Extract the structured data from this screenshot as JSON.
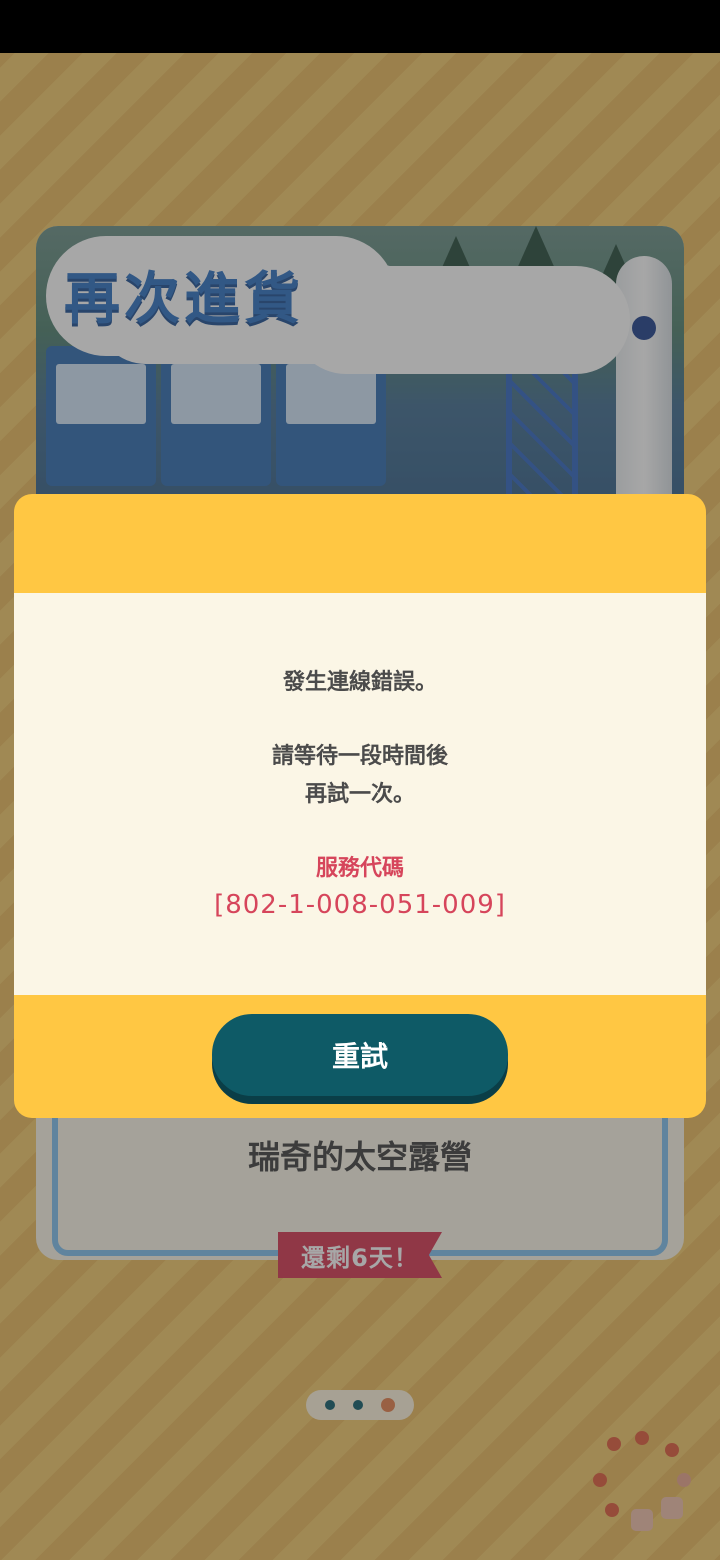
{
  "banner": {
    "title": "再次進貨"
  },
  "event": {
    "title": "瑞奇的太空露營",
    "days_left": "還剩6天！"
  },
  "pager": {
    "count": 3,
    "active_index": 2
  },
  "dialog": {
    "line1": "發生連線錯誤。",
    "line2": "請等待一段時間後",
    "line3": "再試一次。",
    "service_code_label": "服務代碼",
    "service_code": "[802-1-008-051-009]",
    "retry_label": "重試"
  },
  "colors": {
    "dialog_bg": "#ffc743",
    "dialog_body": "#fbf6e6",
    "button": "#0e5a66",
    "error_text": "#d6455b",
    "ribbon": "#d6334f"
  }
}
